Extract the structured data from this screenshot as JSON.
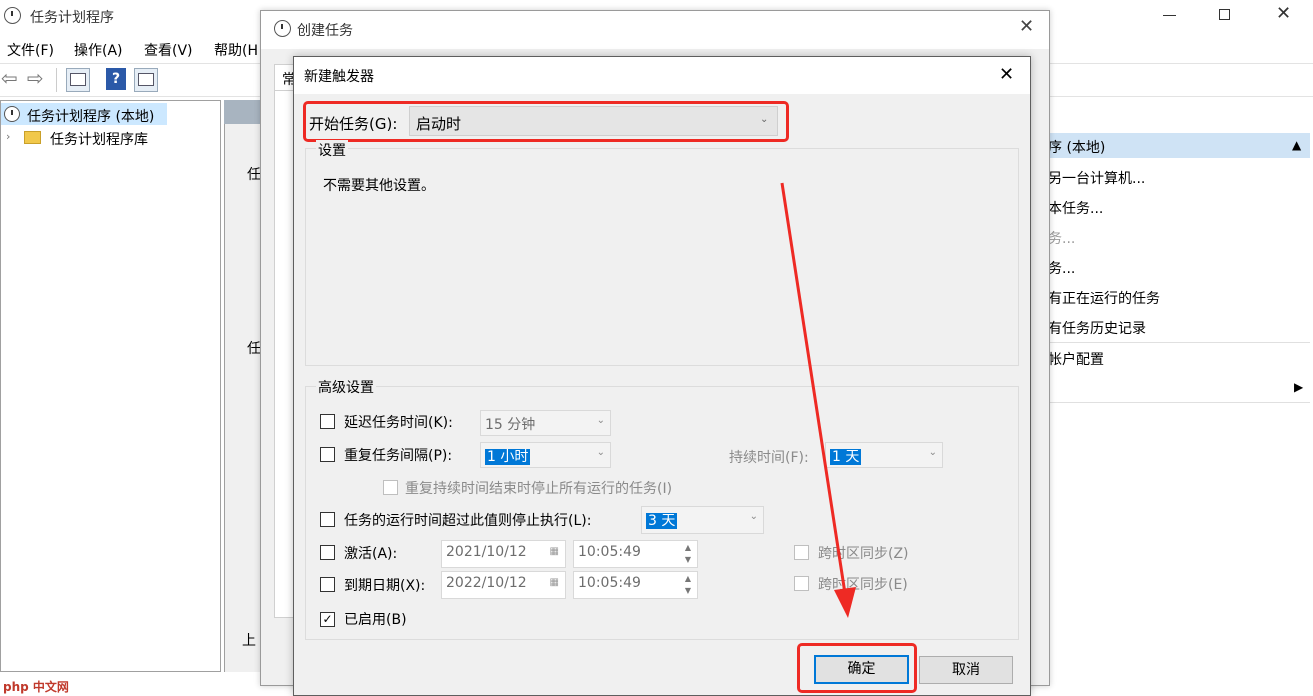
{
  "main_window": {
    "title": "任务计划程序",
    "menu": [
      "文件(F)",
      "操作(A)",
      "查看(V)",
      "帮助(H"
    ],
    "tree": {
      "root": "任务计划程序 (本地)",
      "child": "任务计划程序库"
    },
    "middle_fragments": [
      "任",
      "任",
      "上"
    ],
    "actions": {
      "header": "序 (本地)",
      "items": [
        "另一台计算机...",
        "本任务...",
        "务...",
        "务...",
        "有正在运行的任务",
        "有任务历史记录",
        "帐户配置"
      ]
    }
  },
  "create_task_dialog": {
    "title": "创建任务",
    "tab_fragment": "常"
  },
  "trigger_dialog": {
    "title": "新建触发器",
    "begin_label": "开始任务(G):",
    "begin_value": "启动时",
    "settings_legend": "设置",
    "settings_text": "不需要其他设置。",
    "advanced_legend": "高级设置",
    "delay": {
      "label": "延迟任务时间(K):",
      "value": "15 分钟",
      "checked": false
    },
    "repeat": {
      "label": "重复任务间隔(P):",
      "value": "1 小时",
      "checked": false,
      "duration_label": "持续时间(F):",
      "duration_value": "1 天"
    },
    "stop_all": {
      "label": "重复持续时间结束时停止所有运行的任务(I)",
      "checked": false
    },
    "stop_longer": {
      "label": "任务的运行时间超过此值则停止执行(L):",
      "value": "3 天",
      "checked": false
    },
    "activate": {
      "label": "激活(A):",
      "date": "2021/10/12",
      "time": "10:05:49",
      "sync": "跨时区同步(Z)",
      "checked": false
    },
    "expire": {
      "label": "到期日期(X):",
      "date": "2022/10/12",
      "time": "10:05:49",
      "sync": "跨时区同步(E)",
      "checked": false
    },
    "enabled": {
      "label": "已启用(B)",
      "checked": true
    },
    "ok": "确定",
    "cancel": "取消"
  },
  "watermark": {
    "text": "php 中文网"
  },
  "colors": {
    "annotation_red": "#ee2a24",
    "selection": "#0078d7",
    "action_header": "#cfe3f5"
  }
}
